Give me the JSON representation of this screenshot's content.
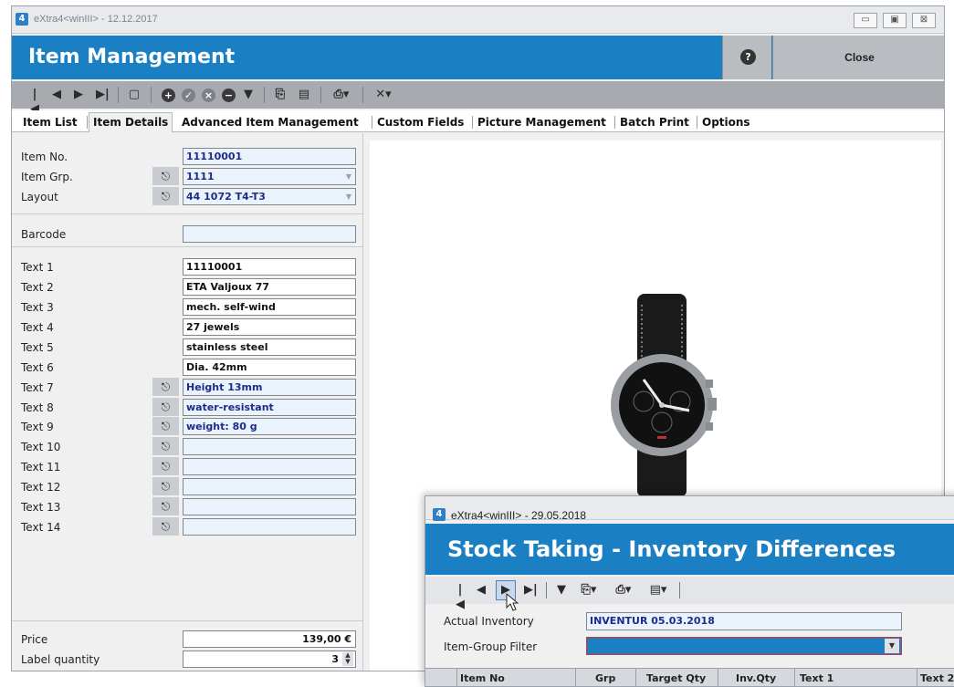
{
  "window1": {
    "title": "eXtra4<winIII> - 12.12.2017",
    "header_title": "Item Management",
    "help_icon": "question-icon",
    "close_label": "Close",
    "tabs": [
      {
        "label": "Item List"
      },
      {
        "label": "Item Details",
        "active": true
      },
      {
        "label": "Advanced Item Management"
      },
      {
        "label": "Custom Fields"
      },
      {
        "label": "Picture Management"
      },
      {
        "label": "Batch Print"
      },
      {
        "label": "Options"
      }
    ],
    "fields": {
      "item_no": {
        "label": "Item No.",
        "value": "11110001"
      },
      "item_grp": {
        "label": "Item Grp.",
        "value": "1111"
      },
      "layout": {
        "label": "Layout",
        "value": "44 1072 T4-T3"
      },
      "barcode": {
        "label": "Barcode",
        "value": ""
      },
      "texts": [
        {
          "label": "Text 1",
          "value": "11110001"
        },
        {
          "label": "Text 2",
          "value": "ETA Valjoux 77"
        },
        {
          "label": "Text 3",
          "value": "mech. self-wind"
        },
        {
          "label": "Text 4",
          "value": "27 jewels"
        },
        {
          "label": "Text 5",
          "value": "stainless steel"
        },
        {
          "label": "Text 6",
          "value": "Dia. 42mm"
        },
        {
          "label": "Text 7",
          "value": "Height 13mm"
        },
        {
          "label": "Text 8",
          "value": "water-resistant"
        },
        {
          "label": "Text 9",
          "value": "weight: 80 g"
        },
        {
          "label": "Text 10",
          "value": ""
        },
        {
          "label": "Text 11",
          "value": ""
        },
        {
          "label": "Text 12",
          "value": ""
        },
        {
          "label": "Text 13",
          "value": ""
        },
        {
          "label": "Text 14",
          "value": ""
        }
      ],
      "price": {
        "label": "Price",
        "value": "139,00 €"
      },
      "label_quantity": {
        "label": "Label quantity",
        "value": "3"
      }
    }
  },
  "window2": {
    "title": "eXtra4<winIII> - 29.05.2018",
    "header_title": "Stock Taking - Inventory Differences",
    "actual_inventory": {
      "label": "Actual Inventory",
      "value": "INVENTUR 05.03.2018"
    },
    "item_group_filter": {
      "label": "Item-Group Filter",
      "value": ""
    },
    "grid_headers": [
      "Item No",
      "Grp",
      "Target Qty",
      "Inv.Qty",
      "Text 1",
      "Text 2"
    ]
  }
}
